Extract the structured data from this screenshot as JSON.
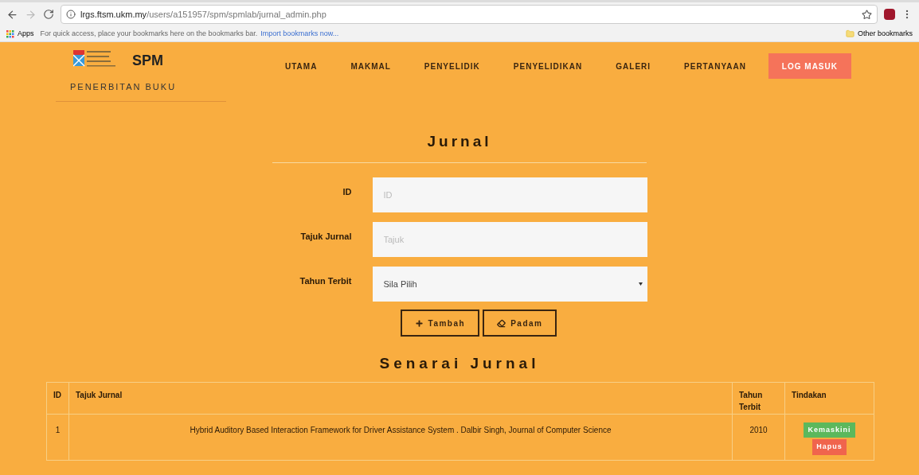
{
  "browser": {
    "url_host": "lrgs.ftsm.ukm.my",
    "url_path": "/users/a151957/spm/spmlab/jurnal_admin.php",
    "apps_label": "Apps",
    "bookmarks_hint": "For quick access, place your bookmarks here on the bookmarks bar.",
    "import_link": "Import bookmarks now...",
    "other_bookmarks": "Other bookmarks"
  },
  "site": {
    "brand": "SPM",
    "subtitle": "PENERBITAN BUKU",
    "nav": [
      {
        "label": "UTAMA",
        "kind": "link"
      },
      {
        "label": "MAKMAL",
        "kind": "link"
      },
      {
        "label": "PENYELIDIK",
        "kind": "link"
      },
      {
        "label": "PENYELIDIKAN",
        "kind": "link"
      },
      {
        "label": "GALERI",
        "kind": "link"
      },
      {
        "label": "PERTANYAAN",
        "kind": "link"
      },
      {
        "label": "LOG MASUK",
        "kind": "button"
      }
    ]
  },
  "form": {
    "title": "Jurnal",
    "fields": [
      {
        "label": "ID",
        "kind": "text",
        "placeholder": "ID"
      },
      {
        "label": "Tajuk Jurnal",
        "kind": "text",
        "placeholder": "Tajuk"
      },
      {
        "label": "Tahun Terbit",
        "kind": "select",
        "value": "Sila Pilih"
      }
    ],
    "buttons": [
      {
        "label": "Tambah",
        "kind": "add"
      },
      {
        "label": "Padam",
        "kind": "erase"
      }
    ]
  },
  "table": {
    "title": "Senarai Jurnal",
    "columns": [
      "ID",
      "Tajuk Jurnal",
      "Tahun Terbit",
      "Tindakan"
    ],
    "rows": [
      {
        "id": "1",
        "title": "Hybrid Auditory Based Interaction Framework for Driver Assistance System . Dalbir Singh, Journal of Computer Science",
        "year": "2010",
        "actions": [
          {
            "label": "Kemaskini",
            "kind": "edit"
          },
          {
            "label": "Hapus",
            "kind": "delete"
          }
        ]
      }
    ]
  }
}
